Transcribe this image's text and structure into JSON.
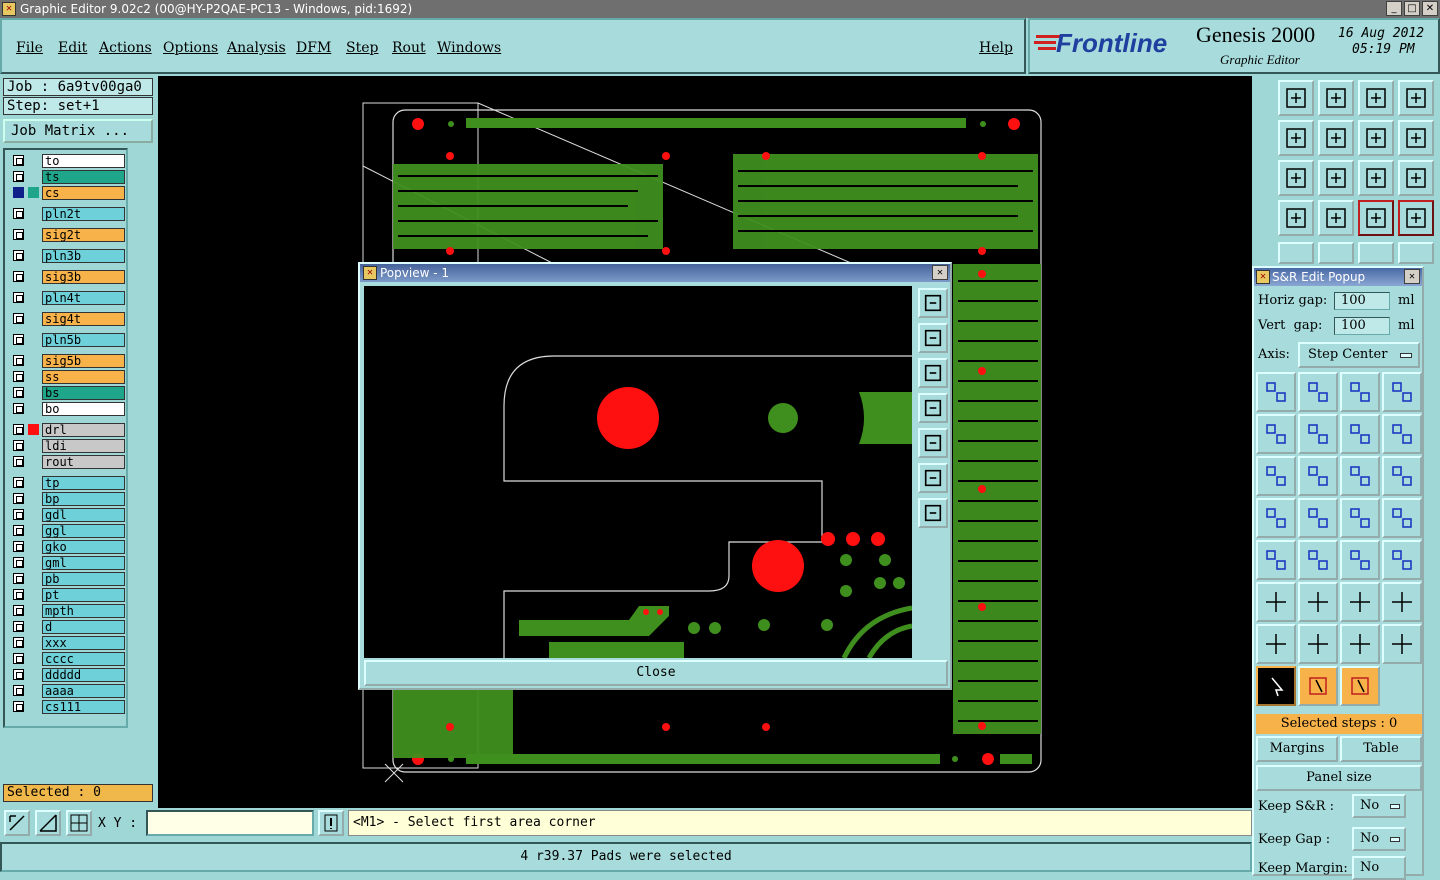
{
  "window": {
    "title": "Graphic Editor 9.02c2 (00@HY-P2QAE-PC13 - Windows, pid:1692)"
  },
  "menu": {
    "file": "File",
    "edit": "Edit",
    "actions": "Actions",
    "options": "Options",
    "analysis": "Analysis",
    "dfm": "DFM",
    "step": "Step",
    "rout": "Rout",
    "windows": "Windows",
    "help": "Help"
  },
  "brand": {
    "logo": "Frontline",
    "product": "Genesis 2000",
    "subtitle": "Graphic Editor",
    "date": "16 Aug 2012",
    "time": "05:19 PM"
  },
  "job": {
    "job_label": "Job : 6a9tv00ga0",
    "step_label": "Step: set+1",
    "matrix_button": "Job Matrix ..."
  },
  "layers": [
    {
      "name": "to",
      "color": "#ffffff"
    },
    {
      "name": "ts",
      "color": "#1fa58a"
    },
    {
      "name": "cs",
      "color": "#f7b24a"
    },
    {
      "name": "pln2t",
      "color": "#6ed0d8"
    },
    {
      "name": "sig2t",
      "color": "#f7b24a"
    },
    {
      "name": "pln3b",
      "color": "#6ed0d8"
    },
    {
      "name": "sig3b",
      "color": "#f7b24a"
    },
    {
      "name": "pln4t",
      "color": "#6ed0d8"
    },
    {
      "name": "sig4t",
      "color": "#f7b24a"
    },
    {
      "name": "pln5b",
      "color": "#6ed0d8"
    },
    {
      "name": "sig5b",
      "color": "#f7b24a"
    },
    {
      "name": "ss",
      "color": "#f7b24a"
    },
    {
      "name": "bs",
      "color": "#1fa58a"
    },
    {
      "name": "bo",
      "color": "#ffffff"
    },
    {
      "name": "drl",
      "color": "#c8c8c8"
    },
    {
      "name": "ldi",
      "color": "#c8c8c8"
    },
    {
      "name": "rout",
      "color": "#c8c8c8"
    },
    {
      "name": "tp",
      "color": "#6ed0d8"
    },
    {
      "name": "bp",
      "color": "#6ed0d8"
    },
    {
      "name": "gdl",
      "color": "#6ed0d8"
    },
    {
      "name": "ggl",
      "color": "#6ed0d8"
    },
    {
      "name": "gko",
      "color": "#6ed0d8"
    },
    {
      "name": "gml",
      "color": "#6ed0d8"
    },
    {
      "name": "pb",
      "color": "#6ed0d8"
    },
    {
      "name": "pt",
      "color": "#6ed0d8"
    },
    {
      "name": "mpth",
      "color": "#6ed0d8"
    },
    {
      "name": "d",
      "color": "#6ed0d8"
    },
    {
      "name": "xxx",
      "color": "#6ed0d8"
    },
    {
      "name": "cccc",
      "color": "#6ed0d8"
    },
    {
      "name": "ddddd",
      "color": "#6ed0d8"
    },
    {
      "name": "aaaa",
      "color": "#6ed0d8"
    },
    {
      "name": "cs111",
      "color": "#6ed0d8"
    }
  ],
  "selected": "Selected : 0",
  "popview": {
    "title": "Popview - 1",
    "close": "Close"
  },
  "sr": {
    "title": "S&R Edit Popup",
    "horiz_label": "Horiz gap:",
    "horiz_value": "100",
    "vert_label": "Vert  gap:",
    "vert_value": "100",
    "unit": "ml",
    "axis_label": "Axis:",
    "axis_value": "Step Center",
    "selected_steps": "Selected steps : 0",
    "margins": "Margins",
    "table": "Table",
    "panel_size": "Panel size",
    "keep_sr": "Keep S&R   :",
    "keep_gap": "Keep Gap    :",
    "keep_margin": "Keep Margin:",
    "no": "No"
  },
  "bottom": {
    "xy_label": "X Y :",
    "prompt": "<M1> - Select first area corner",
    "status": "4 r39.37 Pads were selected"
  },
  "colors": {
    "accent": "#a8dcdc",
    "copper": "#3f8f1f",
    "pad": "#ff1010",
    "highlight": "#f7b24a"
  }
}
